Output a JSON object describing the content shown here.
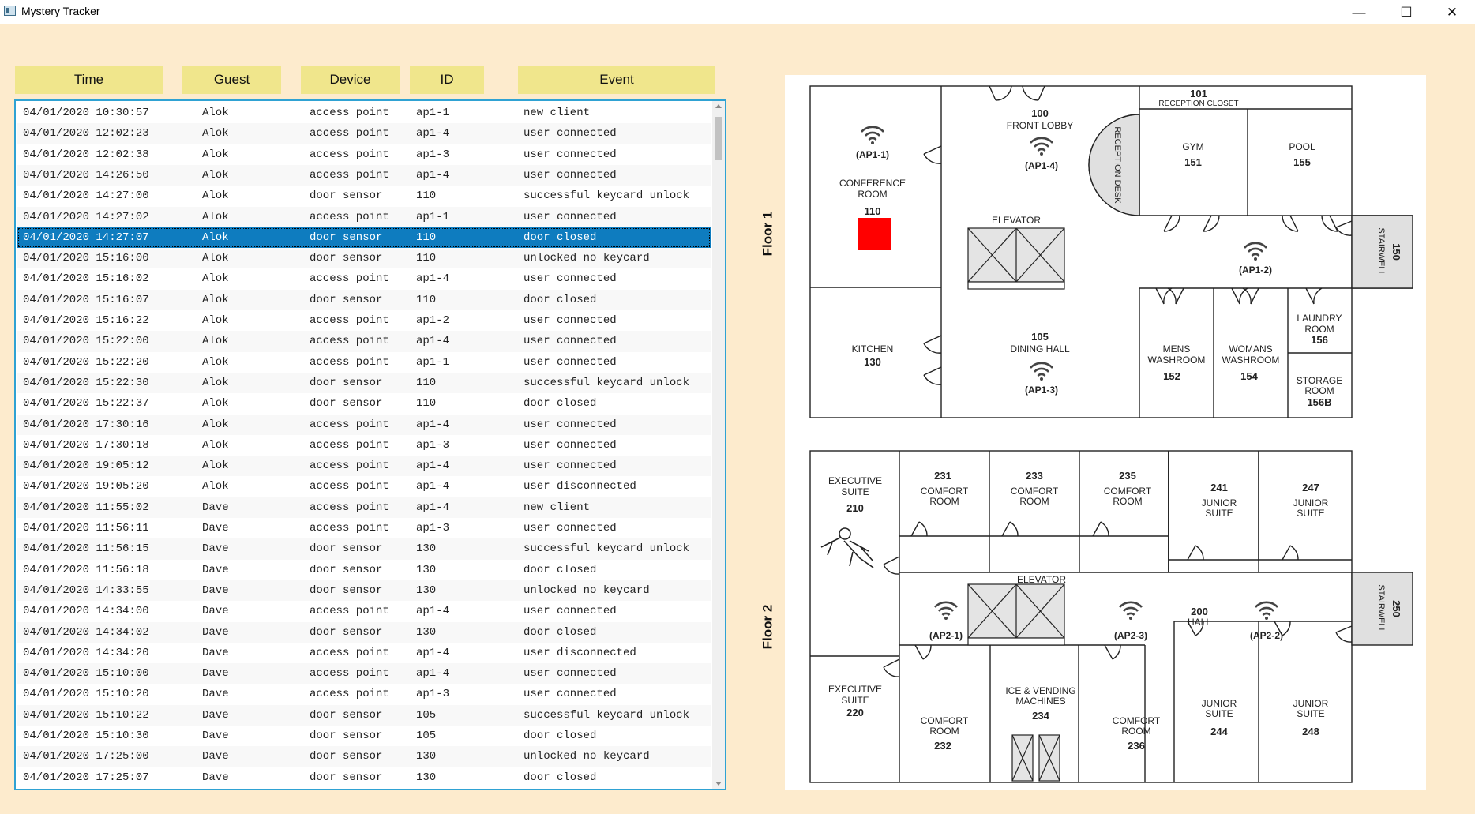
{
  "window": {
    "title": "Mystery Tracker"
  },
  "columns": [
    "Time",
    "Guest",
    "Device",
    "ID",
    "Event"
  ],
  "selected_row": 6,
  "rows": [
    [
      "04/01/2020 10:30:57",
      "Alok",
      "access point",
      "ap1-1",
      "new client"
    ],
    [
      "04/01/2020 12:02:23",
      "Alok",
      "access point",
      "ap1-4",
      "user connected"
    ],
    [
      "04/01/2020 12:02:38",
      "Alok",
      "access point",
      "ap1-3",
      "user connected"
    ],
    [
      "04/01/2020 14:26:50",
      "Alok",
      "access point",
      "ap1-4",
      "user connected"
    ],
    [
      "04/01/2020 14:27:00",
      "Alok",
      "door sensor",
      "110",
      "successful keycard unlock"
    ],
    [
      "04/01/2020 14:27:02",
      "Alok",
      "access point",
      "ap1-1",
      "user connected"
    ],
    [
      "04/01/2020 14:27:07",
      "Alok",
      "door sensor",
      "110",
      "door closed"
    ],
    [
      "04/01/2020 15:16:00",
      "Alok",
      "door sensor",
      "110",
      "unlocked no keycard"
    ],
    [
      "04/01/2020 15:16:02",
      "Alok",
      "access point",
      "ap1-4",
      "user connected"
    ],
    [
      "04/01/2020 15:16:07",
      "Alok",
      "door sensor",
      "110",
      "door closed"
    ],
    [
      "04/01/2020 15:16:22",
      "Alok",
      "access point",
      "ap1-2",
      "user connected"
    ],
    [
      "04/01/2020 15:22:00",
      "Alok",
      "access point",
      "ap1-4",
      "user connected"
    ],
    [
      "04/01/2020 15:22:20",
      "Alok",
      "access point",
      "ap1-1",
      "user connected"
    ],
    [
      "04/01/2020 15:22:30",
      "Alok",
      "door sensor",
      "110",
      "successful keycard unlock"
    ],
    [
      "04/01/2020 15:22:37",
      "Alok",
      "door sensor",
      "110",
      "door closed"
    ],
    [
      "04/01/2020 17:30:16",
      "Alok",
      "access point",
      "ap1-4",
      "user connected"
    ],
    [
      "04/01/2020 17:30:18",
      "Alok",
      "access point",
      "ap1-3",
      "user connected"
    ],
    [
      "04/01/2020 19:05:12",
      "Alok",
      "access point",
      "ap1-4",
      "user connected"
    ],
    [
      "04/01/2020 19:05:20",
      "Alok",
      "access point",
      "ap1-4",
      "user disconnected"
    ],
    [
      "04/01/2020 11:55:02",
      "Dave",
      "access point",
      "ap1-4",
      "new client"
    ],
    [
      "04/01/2020 11:56:11",
      "Dave",
      "access point",
      "ap1-3",
      "user connected"
    ],
    [
      "04/01/2020 11:56:15",
      "Dave",
      "door sensor",
      "130",
      "successful keycard unlock"
    ],
    [
      "04/01/2020 11:56:18",
      "Dave",
      "door sensor",
      "130",
      "door closed"
    ],
    [
      "04/01/2020 14:33:55",
      "Dave",
      "door sensor",
      "130",
      "unlocked no keycard"
    ],
    [
      "04/01/2020 14:34:00",
      "Dave",
      "access point",
      "ap1-4",
      "user connected"
    ],
    [
      "04/01/2020 14:34:02",
      "Dave",
      "door sensor",
      "130",
      "door closed"
    ],
    [
      "04/01/2020 14:34:20",
      "Dave",
      "access point",
      "ap1-4",
      "user disconnected"
    ],
    [
      "04/01/2020 15:10:00",
      "Dave",
      "access point",
      "ap1-4",
      "user connected"
    ],
    [
      "04/01/2020 15:10:20",
      "Dave",
      "access point",
      "ap1-3",
      "user connected"
    ],
    [
      "04/01/2020 15:10:22",
      "Dave",
      "door sensor",
      "105",
      "successful keycard unlock"
    ],
    [
      "04/01/2020 15:10:30",
      "Dave",
      "door sensor",
      "105",
      "door closed"
    ],
    [
      "04/01/2020 17:25:00",
      "Dave",
      "door sensor",
      "130",
      "unlocked no keycard"
    ],
    [
      "04/01/2020 17:25:07",
      "Dave",
      "door sensor",
      "130",
      "door closed"
    ]
  ],
  "map": {
    "floor1_label": "Floor 1",
    "floor2_label": "Floor 2",
    "highlight_color": "#ff0000",
    "floor1": {
      "front_lobby_num": "100",
      "front_lobby": "FRONT LOBBY",
      "reception_closet_num": "101",
      "reception_closet": "RECEPTION CLOSET",
      "reception_desk": "RECEPTION DESK",
      "gym": "GYM",
      "gym_num": "151",
      "pool": "POOL",
      "pool_num": "155",
      "conference_l1": "CONFERENCE",
      "conference_l2": "ROOM",
      "conference_num": "110",
      "elevator": "ELEVATOR",
      "stairwell": "STAIRWELL",
      "stairwell_num": "150",
      "kitchen": "KITCHEN",
      "kitchen_num": "130",
      "dining_num": "105",
      "dining": "DINING HALL",
      "mens_l1": "MENS",
      "mens_l2": "WASHROOM",
      "mens_num": "152",
      "womens_l1": "WOMANS",
      "womens_l2": "WASHROOM",
      "womens_num": "154",
      "laundry_l1": "LAUNDRY",
      "laundry_l2": "ROOM",
      "laundry_num": "156",
      "storage_l1": "STORAGE",
      "storage_l2": "ROOM",
      "storage_num": "156B",
      "ap_1_1": "(AP1-1)",
      "ap_1_2": "(AP1-2)",
      "ap_1_3": "(AP1-3)",
      "ap_1_4": "(AP1-4)"
    },
    "floor2": {
      "exec1_l1": "EXECUTIVE",
      "exec1_l2": "SUITE",
      "exec1_num": "210",
      "r231_num": "231",
      "r233_num": "233",
      "r235_num": "235",
      "comfort_l1": "COMFORT",
      "comfort_l2": "ROOM",
      "r241_num": "241",
      "r247_num": "247",
      "junior_l1": "JUNIOR",
      "junior_l2": "SUITE",
      "elevator": "ELEVATOR",
      "hall_num": "200",
      "hall": "HALL",
      "stairwell": "STAIRWELL",
      "stairwell_num": "250",
      "exec2_num": "220",
      "ice_l1": "ICE & VENDING",
      "ice_l2": "MACHINES",
      "ice_num": "234",
      "r232_num": "232",
      "r236_num": "236",
      "r244_num": "244",
      "r248_num": "248",
      "ap_2_1": "(AP2-1)",
      "ap_2_2": "(AP2-2)",
      "ap_2_3": "(AP2-3)"
    }
  }
}
